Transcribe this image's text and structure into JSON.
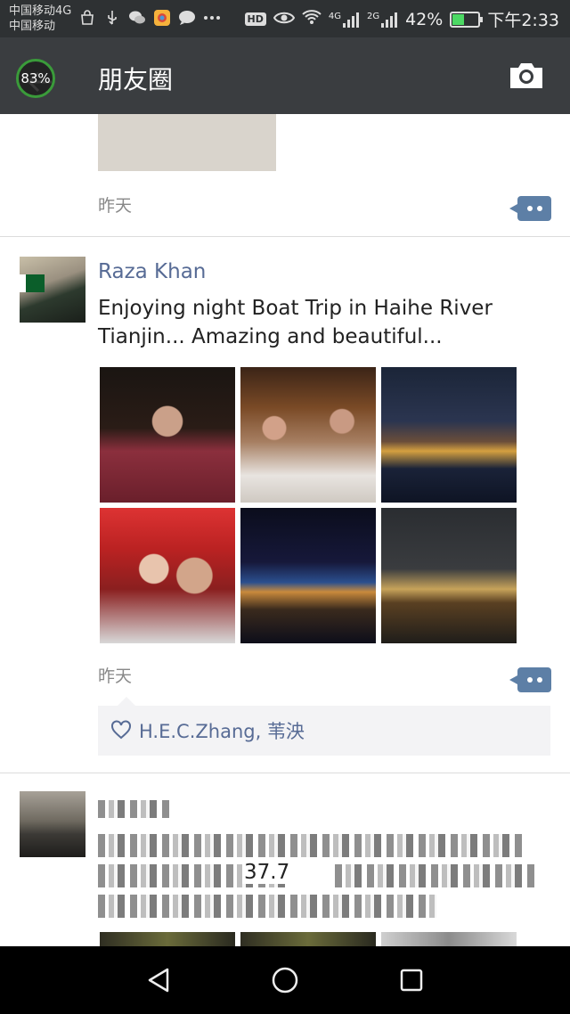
{
  "status_bar": {
    "carrier1": "中国移动4G",
    "carrier2": "中国移动",
    "hd": "HD",
    "net1": "4G",
    "net2": "2G",
    "battery": "42%",
    "time": "下午2:33"
  },
  "header": {
    "title": "朋友圈",
    "overlay_percent": "83%"
  },
  "posts": [
    {
      "time": "昨天"
    },
    {
      "author": "Raza Khan",
      "text": "Enjoying night Boat Trip in Haihe River Tianjin... Amazing and beautiful...",
      "time": "昨天",
      "likes": "H.E.C.Zhang, 苇泱",
      "photo_count": 6
    },
    {
      "visible_text": "37.7"
    }
  ],
  "colors": {
    "titlebar": "#3a3d40",
    "link": "#576b95",
    "accent_blue": "#5d7fa6"
  }
}
